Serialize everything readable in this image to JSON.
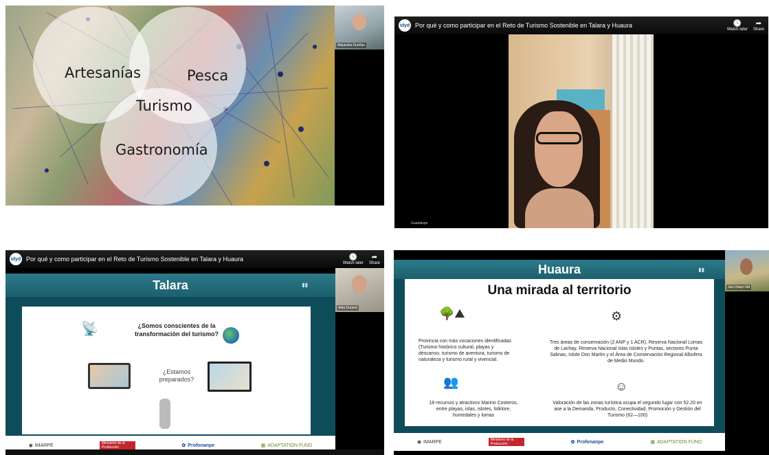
{
  "panel1": {
    "venn": [
      "Artesanías",
      "Pesca",
      "Turismo",
      "Gastronomía"
    ],
    "participant_name": "Alejandra Dueñas"
  },
  "panel2": {
    "video_title": "Por qué y como participar en el Reto de Turismo Sostenible en Talara y Huaura",
    "logo_text": "idyd",
    "watch_later": "Watch later",
    "share": "Share",
    "cam_name": "Guadalupe"
  },
  "panel3": {
    "video_title": "Por qué y como participar en el Reto de Turismo Sostenible en Talara y Huaura",
    "logo_text": "idyd",
    "watch_later": "Watch later",
    "share": "Share",
    "slide_title": "Talara",
    "question": "¿Somos conscientes de la transformación del turismo?",
    "prepared": "¿Estamos preparados?",
    "participant_name": "Aida Durand",
    "logos": [
      "IMARPE",
      "Ministerio de la Producción",
      "Profonanpe",
      "ADAPTATION FUND"
    ]
  },
  "panel4": {
    "slide_title": "Huaura",
    "heading": "Una mirada al territorio",
    "block1": "Provincia con más vocaciones identificadas (Turismo histórico cultural, playas y descanso, turismo de aventura, turismo de naturaleza y turismo rural y vivencial.",
    "block2": "Tres áreas de conservación (2 ANP y 1 ACR), Reserva Nacional Lomas de Lachay, Reserva Nacional Islas Islotes y Puntas, sectores Punta Salinas, Islote Don Martín y el Área de Conservación Regional Albufera de Medio Mundo.",
    "block3": "18 recursos y atractivos Marino Costeros, entre playas, islas, islotes, folklore, humedales y lomas",
    "block4": "Valoración de las zonas turística ocupa el segundo lugar con 52.20 en ase a la Demanda, Producto, Conectividad, Promoción y Gestión del Turismo (62—100)",
    "participant_name": "Jaro Naqvi Idd",
    "logos": [
      "IMARPE",
      "Ministerio de la Producción",
      "Profonanpe",
      "ADAPTATION FUND"
    ]
  }
}
